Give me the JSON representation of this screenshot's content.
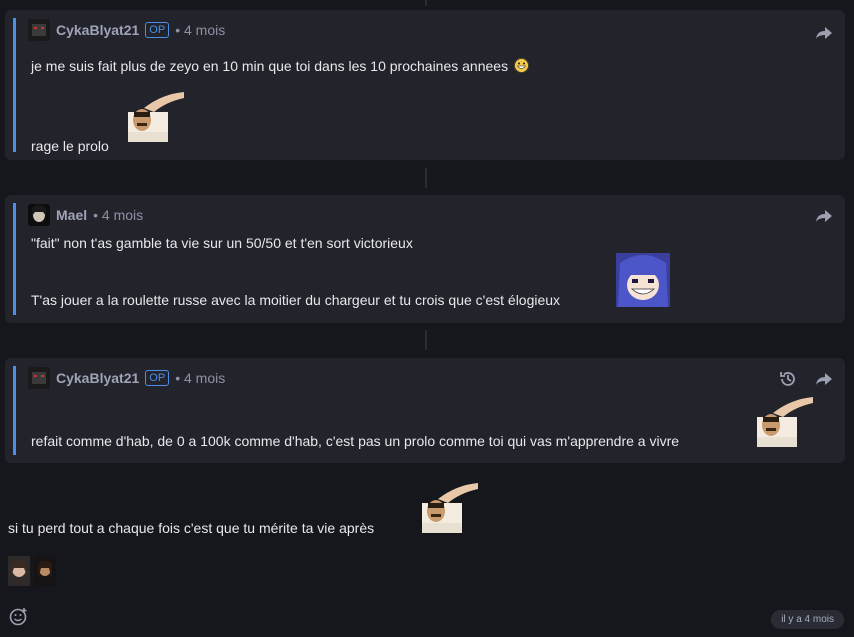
{
  "posts": [
    {
      "author": "CykaBlyat21",
      "op_badge": "OP",
      "time": "• 4 mois",
      "line1": "je me suis fait plus de zeyo en 10 min que toi dans les 10 prochaines annees",
      "line2": "rage le prolo",
      "icons": [
        "share-icon"
      ]
    },
    {
      "author": "Mael",
      "time": "• 4 mois",
      "line1": "\"fait\" non t'as gamble ta vie sur un 50/50 et t'en sort victorieux",
      "line2": "T'as jouer a la roulette russe avec la moitier du chargeur et tu crois que c'est élogieux",
      "icons": [
        "share-icon"
      ]
    },
    {
      "author": "CykaBlyat21",
      "op_badge": "OP",
      "time": "• 4 mois",
      "line1": "refait comme d'hab, de 0 a 100k comme d'hab, c'est pas un prolo comme toi qui vas m'apprendre a vivre",
      "icons": [
        "history-icon",
        "share-icon"
      ]
    }
  ],
  "reply": {
    "text": "si tu perd tout a chaque fois c'est que tu mérite ta vie après"
  },
  "footer": {
    "time_badge": "il y a 4 mois"
  },
  "colors": {
    "background": "#16171d",
    "card": "#22232b",
    "accent": "#4a8fe8"
  }
}
